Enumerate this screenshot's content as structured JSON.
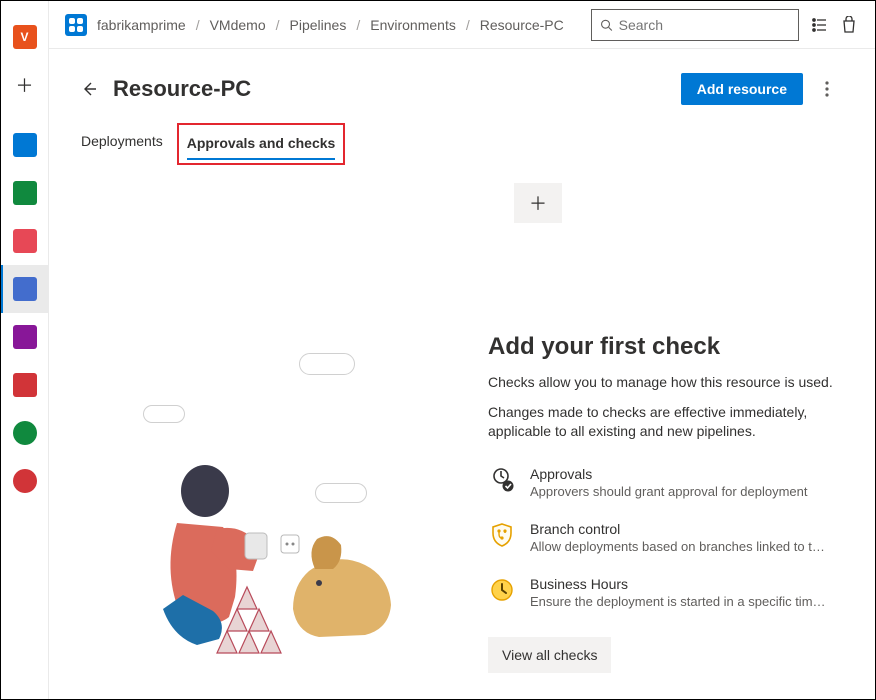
{
  "breadcrumb": [
    "fabrikamprime",
    "VMdemo",
    "Pipelines",
    "Environments",
    "Resource-PC"
  ],
  "search": {
    "placeholder": "Search"
  },
  "page": {
    "title": "Resource-PC",
    "add_button": "Add resource"
  },
  "tabs": {
    "deployments": "Deployments",
    "approvals": "Approvals and checks"
  },
  "panel": {
    "heading": "Add your first check",
    "desc1": "Checks allow you to manage how this resource is used.",
    "desc2": "Changes made to checks are effective immediately, applicable to all existing and new pipelines.",
    "view_all": "View all checks"
  },
  "checks": [
    {
      "name": "Approvals",
      "sub": "Approvers should grant approval for deployment"
    },
    {
      "name": "Branch control",
      "sub": "Allow deployments based on branches linked to the run"
    },
    {
      "name": "Business Hours",
      "sub": "Ensure the deployment is started in a specific time win…"
    }
  ],
  "rail": {
    "items": [
      {
        "id": "project",
        "letter": "V",
        "color": "#e8511c"
      },
      {
        "id": "add",
        "plus": true
      },
      {
        "id": "boards",
        "color": "#0078d4"
      },
      {
        "id": "repos",
        "color": "#10893e"
      },
      {
        "id": "pipelines-red",
        "color": "#e74856"
      },
      {
        "id": "pipelines",
        "color": "#436dcd",
        "selected": true
      },
      {
        "id": "test",
        "color": "#881798"
      },
      {
        "id": "artifacts",
        "color": "#d13438"
      },
      {
        "id": "security",
        "color": "#10893e"
      },
      {
        "id": "ext",
        "color": "#d13438"
      }
    ]
  }
}
